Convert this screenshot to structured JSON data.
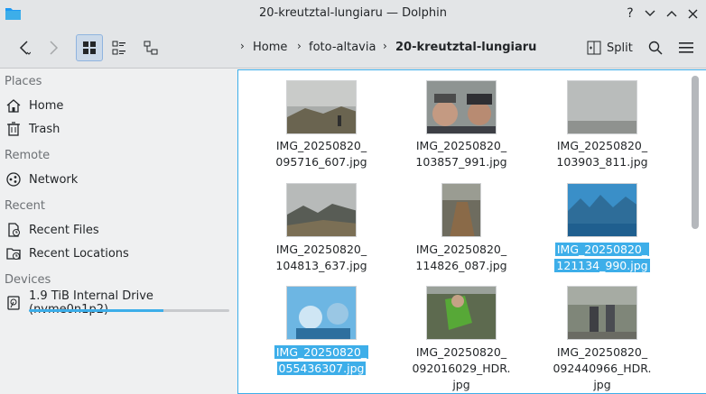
{
  "window": {
    "title": "20-kreutztal-lungiaru — Dolphin"
  },
  "toolbar": {
    "breadcrumb": [
      "Home",
      "foto-altavia",
      "20-kreutztal-lungiaru"
    ],
    "split_label": "Split"
  },
  "sidebar": {
    "sections": {
      "places": "Places",
      "remote": "Remote",
      "recent": "Recent",
      "devices": "Devices"
    },
    "items": {
      "home": "Home",
      "trash": "Trash",
      "network": "Network",
      "recent_files": "Recent Files",
      "recent_locations": "Recent Locations",
      "drive": "1.9 TiB Internal Drive (nvme0n1p2)"
    },
    "drive_usage_fraction": 0.67
  },
  "files": [
    {
      "line1": "IMG_20250820_",
      "line2": "095716_607.jpg",
      "line3": "",
      "selected": false
    },
    {
      "line1": "IMG_20250820_",
      "line2": "103857_991.jpg",
      "line3": "",
      "selected": false
    },
    {
      "line1": "IMG_20250820_",
      "line2": "103903_811.jpg",
      "line3": "",
      "selected": false
    },
    {
      "line1": "IMG_20250820_",
      "line2": "104813_637.jpg",
      "line3": "",
      "selected": false
    },
    {
      "line1": "IMG_20250820_",
      "line2": "114826_087.jpg",
      "line3": "",
      "selected": false
    },
    {
      "line1": "IMG_20250820_",
      "line2": "121134_990.jpg",
      "line3": "",
      "selected": true
    },
    {
      "line1": "IMG_20250820_",
      "line2": "055436307.jpg",
      "line3": "",
      "selected": true
    },
    {
      "line1": "IMG_20250820_",
      "line2": "092016029_HDR.",
      "line3": "jpg",
      "selected": false
    },
    {
      "line1": "IMG_20250820_",
      "line2": "092440966_HDR.",
      "line3": "jpg",
      "selected": false
    }
  ],
  "colors": {
    "accent": "#3daee9",
    "window_bg": "#eff0f1",
    "titlebar_bg": "#e3e5e7"
  }
}
